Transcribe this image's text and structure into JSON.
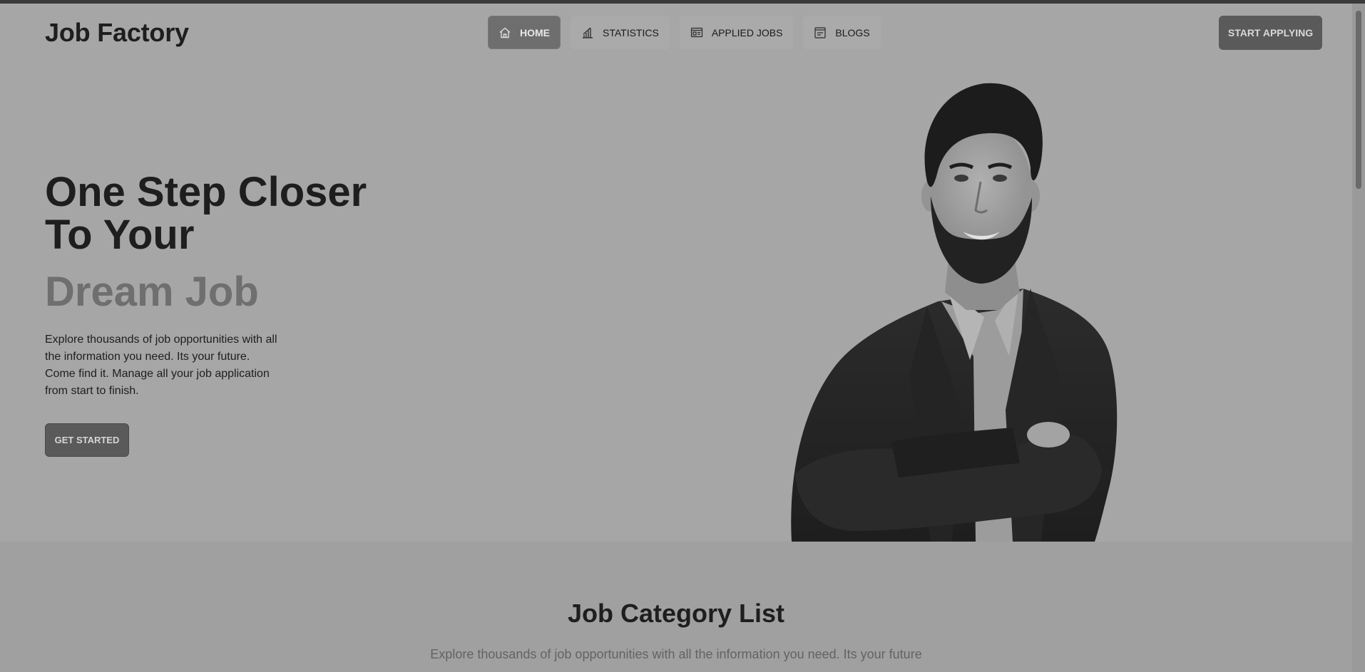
{
  "header": {
    "brand": "Job Factory",
    "nav": [
      {
        "label": "HOME",
        "icon": "home-icon",
        "active": true
      },
      {
        "label": "STATISTICS",
        "icon": "chart-icon",
        "active": false
      },
      {
        "label": "APPLIED JOBS",
        "icon": "briefcase-window-icon",
        "active": false
      },
      {
        "label": "BLOGS",
        "icon": "blog-icon",
        "active": false
      }
    ],
    "cta": "START APPLYING"
  },
  "hero": {
    "title": "One Step Closer To Your",
    "accent": "Dream Job",
    "description": "Explore thousands of job opportunities with all the information you need. Its your future. Come find it. Manage all your job application from start to finish.",
    "button": "GET STARTED"
  },
  "category_section": {
    "title": "Job Category List",
    "subtitle": "Explore thousands of job opportunities with all the information you need. Its your future"
  },
  "colors": {
    "background": "#a6a6a6",
    "active_nav": "#6e6e6e",
    "button": "#5a5a5a",
    "accent_text": "#6f6f6f"
  }
}
